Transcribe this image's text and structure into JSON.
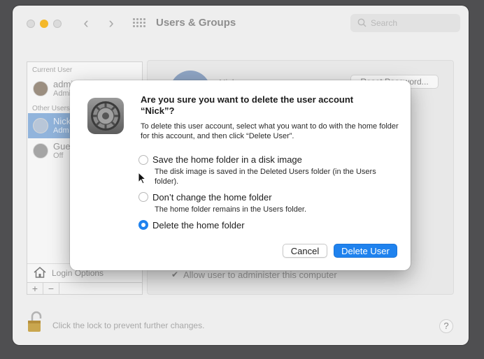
{
  "window": {
    "title": "Users & Groups",
    "search_placeholder": "Search"
  },
  "sidebar": {
    "current_user_header": "Current User",
    "other_users_header": "Other Users",
    "users": [
      {
        "name": "admi",
        "subtitle": "Admi"
      },
      {
        "name": "Nick",
        "subtitle": "Adm"
      },
      {
        "name": "Gues",
        "subtitle": "Off"
      }
    ],
    "login_options_label": "Login Options",
    "add_symbol": "+",
    "remove_symbol": "−"
  },
  "detail": {
    "user_name": "Nick",
    "reset_password_label": "Reset Password...",
    "allow_admin_label": "Allow user to administer this computer",
    "allow_admin_checked": true
  },
  "footer": {
    "lock_text": "Click the lock to prevent further changes.",
    "help_label": "?"
  },
  "dialog": {
    "title": "Are you sure you want to delete the user account “Nick”?",
    "message": "To delete this user account, select what you want to do with the home folder for this account, and then click “Delete User”.",
    "options": [
      {
        "label": "Save the home folder in a disk image",
        "description": "The disk image is saved in the Deleted Users folder (in the Users folder).",
        "selected": false
      },
      {
        "label": "Don’t change the home folder",
        "description": "The home folder remains in the Users folder.",
        "selected": false
      },
      {
        "label": "Delete the home folder",
        "description": "",
        "selected": true
      }
    ],
    "cancel_label": "Cancel",
    "confirm_label": "Delete User",
    "accent_color": "#1f82ee"
  }
}
